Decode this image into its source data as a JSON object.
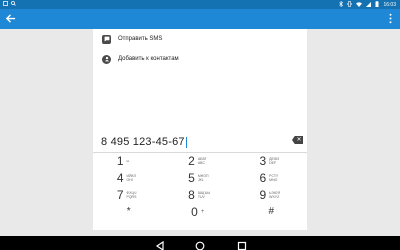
{
  "status_bar": {
    "left_icons": [
      "notification-icon",
      "search-icon"
    ],
    "right_icons": [
      "bluetooth-icon",
      "vibrate-icon",
      "wifi-icon",
      "signal-icon",
      "battery-icon"
    ],
    "time": "16:03"
  },
  "action_bar": {
    "back_icon": "arrow-left-icon",
    "menu_icon": "overflow-menu-icon",
    "color": "#1e88d6"
  },
  "actions": [
    {
      "label": "Отправить SMS",
      "icon": "sms-icon"
    },
    {
      "label": "Добавить к контактам",
      "icon": "add-contact-icon"
    }
  ],
  "number": "8 495 123-45-67",
  "keypad": [
    [
      {
        "digit": "1",
        "letters": [
          "ω",
          ""
        ]
      },
      {
        "digit": "2",
        "letters": [
          "АБВГ",
          "ABC"
        ]
      },
      {
        "digit": "3",
        "letters": [
          "ДЕЖЗ",
          "DEF"
        ]
      }
    ],
    [
      {
        "digit": "4",
        "letters": [
          "ИЙКЛ",
          "GHI"
        ]
      },
      {
        "digit": "5",
        "letters": [
          "МНОП",
          "JKL"
        ]
      },
      {
        "digit": "6",
        "letters": [
          "РСТУ",
          "MNO"
        ]
      }
    ],
    [
      {
        "digit": "7",
        "letters": [
          "ФХЦЧ",
          "PQRS"
        ]
      },
      {
        "digit": "8",
        "letters": [
          "ШЩЪЫ",
          "TUV"
        ]
      },
      {
        "digit": "9",
        "letters": [
          "ЬЭЮЯ",
          "WXYZ"
        ]
      }
    ],
    [
      {
        "digit": "*",
        "letters": [
          "",
          ""
        ]
      },
      {
        "digit": "0",
        "letters": [
          "+",
          ""
        ]
      },
      {
        "digit": "#",
        "letters": [
          "",
          ""
        ]
      }
    ]
  ],
  "colors": {
    "status_bar": "#1472b3",
    "action_bar": "#1e88d6",
    "call_button": "#13a89e",
    "cursor": "#1e88d6"
  },
  "nav_bar": {
    "buttons": [
      "back-icon",
      "home-icon",
      "recents-icon"
    ]
  }
}
